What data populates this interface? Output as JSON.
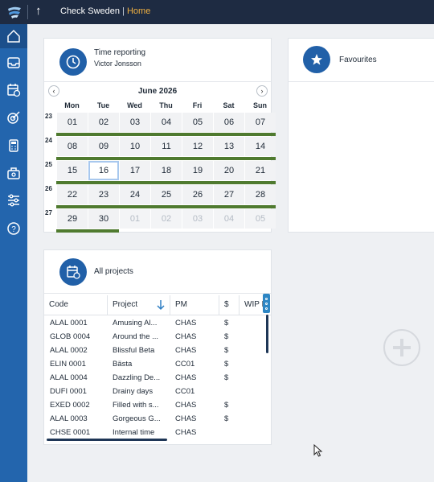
{
  "topbar": {
    "app_title": "Check Sweden",
    "separator": "|",
    "home_label": "Home",
    "up_icon": "arrow-up-icon"
  },
  "sidebar": {
    "items": [
      {
        "name": "home",
        "icon": "home-icon"
      },
      {
        "name": "inbox",
        "icon": "inbox-icon"
      },
      {
        "name": "calendar-check",
        "icon": "calendar-check-icon"
      },
      {
        "name": "target",
        "icon": "target-icon"
      },
      {
        "name": "calculator",
        "icon": "calculator-icon"
      },
      {
        "name": "toolbox",
        "icon": "toolbox-icon"
      },
      {
        "name": "settings",
        "icon": "sliders-icon"
      },
      {
        "name": "help",
        "icon": "help-icon"
      }
    ]
  },
  "time_reporting": {
    "title": "Time reporting",
    "user": "Victor Jonsson",
    "prev": "‹",
    "next": "›",
    "month": "June 2026",
    "weekdays": [
      "Mon",
      "Tue",
      "Wed",
      "Thu",
      "Fri",
      "Sat",
      "Sun"
    ],
    "weeks": [
      {
        "no": "23",
        "days": [
          "01",
          "02",
          "03",
          "04",
          "05",
          "06",
          "07"
        ],
        "dim": [
          false,
          false,
          false,
          false,
          false,
          false,
          false
        ],
        "bar_days": 7
      },
      {
        "no": "24",
        "days": [
          "08",
          "09",
          "10",
          "11",
          "12",
          "13",
          "14"
        ],
        "dim": [
          false,
          false,
          false,
          false,
          false,
          false,
          false
        ],
        "bar_days": 7
      },
      {
        "no": "25",
        "days": [
          "15",
          "16",
          "17",
          "18",
          "19",
          "20",
          "21"
        ],
        "dim": [
          false,
          false,
          false,
          false,
          false,
          false,
          false
        ],
        "bar_days": 7
      },
      {
        "no": "26",
        "days": [
          "22",
          "23",
          "24",
          "25",
          "26",
          "27",
          "28"
        ],
        "dim": [
          false,
          false,
          false,
          false,
          false,
          false,
          false
        ],
        "bar_days": 7
      },
      {
        "no": "27",
        "days": [
          "29",
          "30",
          "01",
          "02",
          "03",
          "04",
          "05"
        ],
        "dim": [
          false,
          false,
          true,
          true,
          true,
          true,
          true
        ],
        "bar_days": 2
      }
    ],
    "today": "16"
  },
  "favourites": {
    "title": "Favourites"
  },
  "all_projects": {
    "title": "All projects",
    "columns": [
      "Code",
      "Project",
      "PM",
      "$",
      "WIP I"
    ],
    "sort_icon": "arrow-down-icon",
    "rows": [
      [
        "ALAL 0001",
        "Amusing Al...",
        "CHAS",
        "$"
      ],
      [
        "GLOB 0004",
        "Around the ...",
        "CHAS",
        "$"
      ],
      [
        "ALAL 0002",
        "Blissful Beta",
        "CHAS",
        "$"
      ],
      [
        "ELIN 0001",
        "Bästa",
        "CC01",
        "$"
      ],
      [
        "ALAL 0004",
        "Dazzling De...",
        "CHAS",
        "$"
      ],
      [
        "DUFI 0001",
        "Drainy days",
        "CC01",
        ""
      ],
      [
        "EXED 0002",
        "Filled with s...",
        "CHAS",
        "$"
      ],
      [
        "ALAL 0003",
        "Gorgeous G...",
        "CHAS",
        "$"
      ],
      [
        "CHSE 0001",
        "Internal time",
        "CHAS",
        ""
      ]
    ]
  }
}
